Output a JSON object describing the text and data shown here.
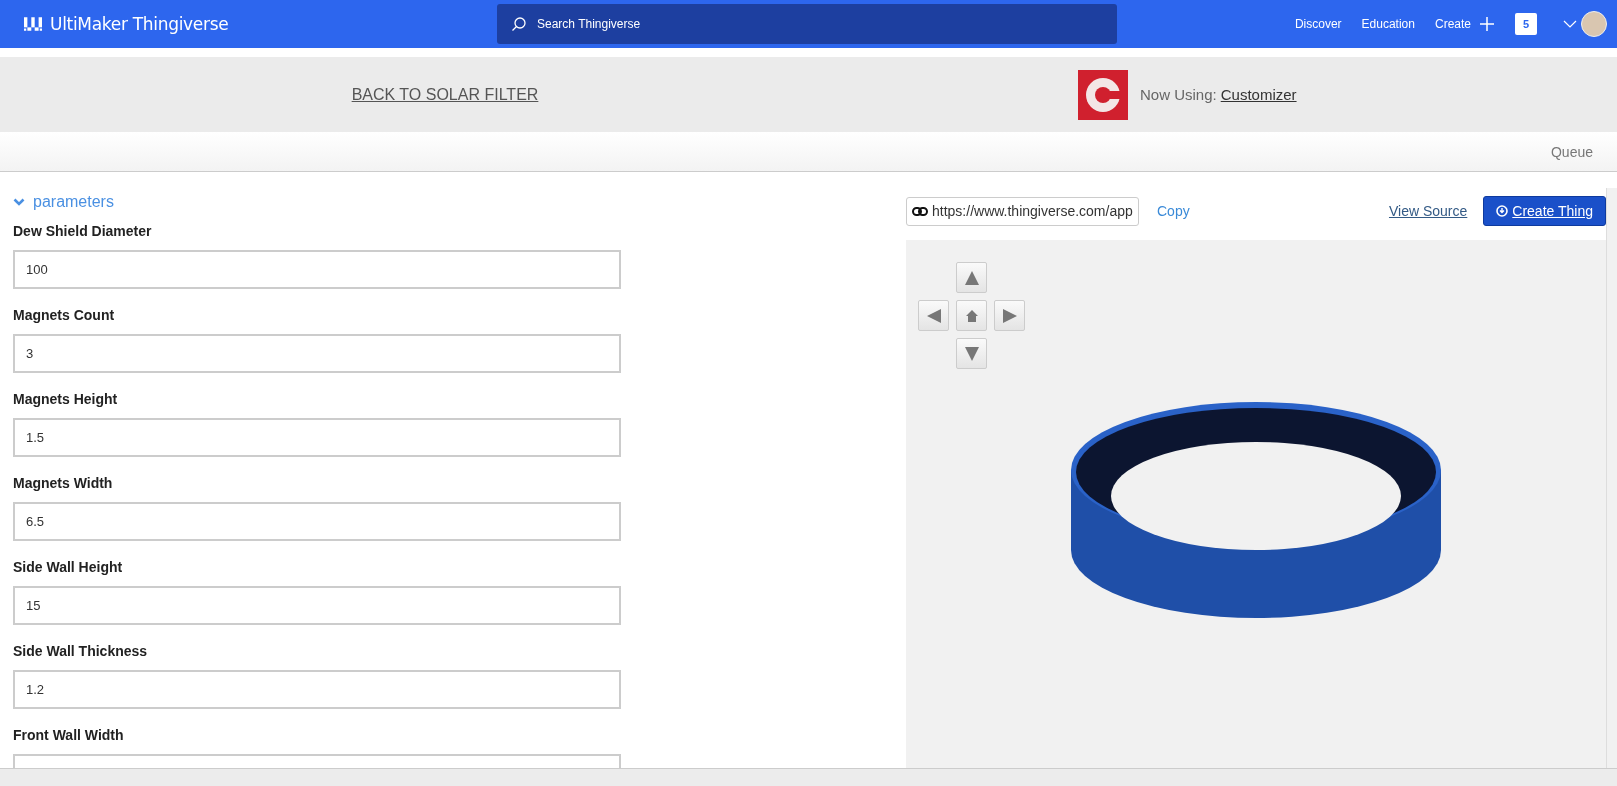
{
  "header": {
    "brand": "UltiMaker Thingiverse",
    "search": {
      "placeholder": "Search Thingiverse"
    },
    "nav": [
      "Discover",
      "Education",
      "Create"
    ],
    "notification_count": "5"
  },
  "banner": {
    "back_link": "BACK TO SOLAR FILTER",
    "now_using_label": "Now Using:",
    "app_link": "Customizer"
  },
  "queue_bar": {
    "label": "Queue"
  },
  "parameters": {
    "title": "parameters",
    "expanded": true,
    "fields": [
      {
        "label": "Dew Shield Diameter",
        "value": "100"
      },
      {
        "label": "Magnets Count",
        "value": "3"
      },
      {
        "label": "Magnets Height",
        "value": "1.5"
      },
      {
        "label": "Magnets Width",
        "value": "6.5"
      },
      {
        "label": "Side Wall Height",
        "value": "15"
      },
      {
        "label": "Side Wall Thickness",
        "value": "1.2"
      },
      {
        "label": "Front Wall Width"
      }
    ]
  },
  "viewer": {
    "share_url": "https://www.thingiverse.com/app",
    "copy": "Copy",
    "view_source": "View Source",
    "create_button": "Create Thing"
  }
}
